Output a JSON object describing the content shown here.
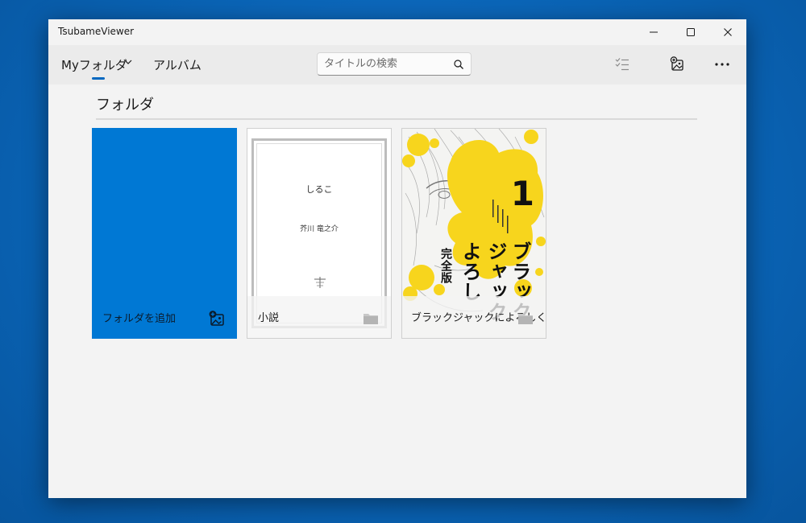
{
  "window": {
    "title": "TsubameViewer",
    "controls": {
      "minimize": "—",
      "maximize": "☐",
      "close": "✕"
    }
  },
  "nav": {
    "items": [
      {
        "label": "Myフォルダ",
        "selected": true,
        "has_dropdown": true
      },
      {
        "label": "アルバム",
        "selected": false
      }
    ],
    "accent_color": "#0067c0"
  },
  "search": {
    "placeholder": "タイトルの検索",
    "value": ""
  },
  "toolbar": {
    "icons": [
      "checklist-icon",
      "add-image-icon",
      "more-icon"
    ],
    "more_label": "···"
  },
  "section": {
    "title": "フォルダ"
  },
  "folders": [
    {
      "label": "フォルダを追加",
      "type": "add",
      "color": "#0078d4",
      "icon": "add-image-icon"
    },
    {
      "label": "小説",
      "type": "folder",
      "icon": "folder-icon",
      "cover": {
        "title": "しるこ",
        "author": "芥川 竜之介"
      }
    },
    {
      "label": "ブラックジャックによろしく",
      "type": "folder",
      "icon": "folder-icon",
      "cover": {
        "volume": "1",
        "title_col1": "ブラック",
        "title_col2": "ジャック",
        "title_col3": "よろし",
        "edition": "完全版",
        "accent": "#f7d51d"
      }
    }
  ]
}
